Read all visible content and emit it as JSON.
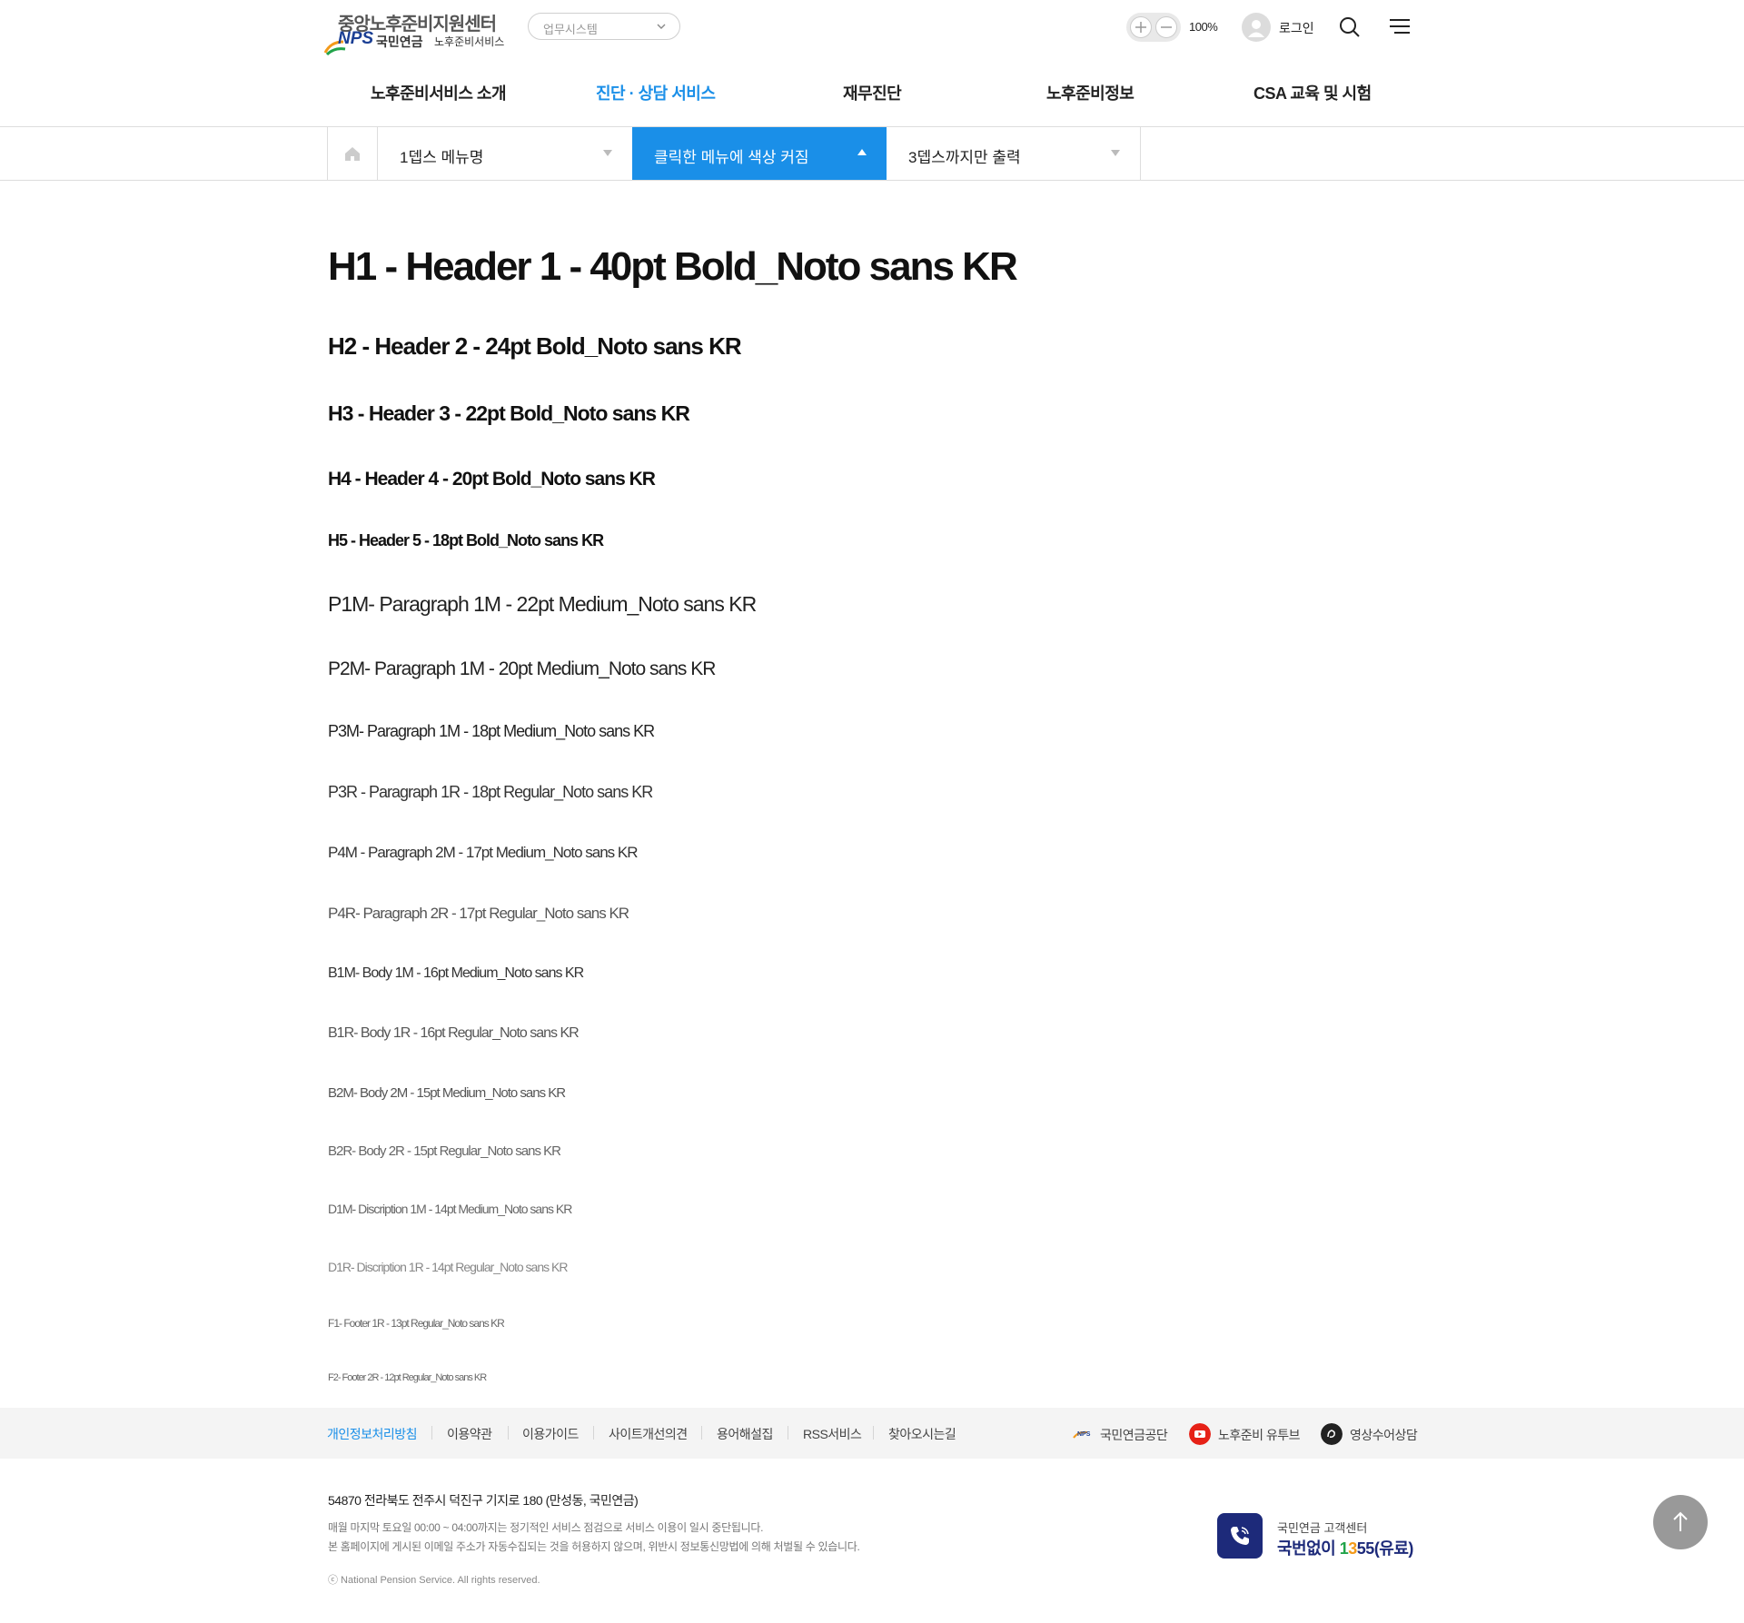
{
  "header": {
    "logo": {
      "center_name": "중앙노후준비지원센터",
      "nps": "NPS",
      "org": "국민연금",
      "service": "노후준비서비스"
    },
    "system_select": {
      "value": "업무시스템"
    },
    "zoom_value": "100%",
    "login_label": "로그인"
  },
  "gnb": {
    "items": [
      {
        "label": "노후준비서비스 소개"
      },
      {
        "label": "진단 · 상담 서비스",
        "active": true
      },
      {
        "label": "재무진단"
      },
      {
        "label": "노후준비정보"
      },
      {
        "label": "CSA 교육 및 시험"
      }
    ]
  },
  "lnb": {
    "depth1": "1뎁스 메뉴명",
    "depth2": "클릭한 메뉴에 색상 커짐",
    "depth3": "3뎁스까지만 출력"
  },
  "typography": {
    "h1": "H1 - Header 1 - 40pt Bold_Noto sans KR",
    "h2": "H2 - Header 2 - 24pt Bold_Noto sans KR",
    "h3": "H3 - Header 3 - 22pt Bold_Noto sans KR",
    "h4": "H4 - Header 4 - 20pt Bold_Noto sans KR",
    "h5": "H5 - Header 5 - 18pt Bold_Noto sans KR",
    "p1m": "P1M- Paragraph 1M - 22pt Medium_Noto sans KR",
    "p2m": "P2M- Paragraph 1M - 20pt Medium_Noto sans KR",
    "p3m": "P3M- Paragraph 1M - 18pt Medium_Noto sans KR",
    "p3r": "P3R - Paragraph 1R - 18pt Regular_Noto sans KR",
    "p4m": "P4M - Paragraph 2M - 17pt Medium_Noto sans KR",
    "p4r": "P4R- Paragraph 2R - 17pt Regular_Noto sans KR",
    "b1m": "B1M- Body 1M - 16pt Medium_Noto sans KR",
    "b1r": "B1R- Body 1R - 16pt Regular_Noto sans KR",
    "b2m": "B2M- Body 2M - 15pt Medium_Noto sans KR",
    "b2r": "B2R- Body 2R - 15pt Regular_Noto sans KR",
    "d1m": "D1M- Discription 1M - 14pt Medium_Noto sans KR",
    "d1r": "D1R- Discription 1R - 14pt Regular_Noto sans KR",
    "f1": "F1- Footer 1R - 13pt Regular_Noto sans KR",
    "f2": "F2- Footer 2R - 12pt Regular_Noto sans KR"
  },
  "footer": {
    "links": [
      {
        "label": "개인정보처리방침",
        "highlight": true
      },
      {
        "label": "이용약관"
      },
      {
        "label": "이용가이드"
      },
      {
        "label": "사이트개선의견"
      },
      {
        "label": "용어해설집"
      },
      {
        "label": "RSS서비스"
      },
      {
        "label": "찾아오시는길"
      }
    ],
    "family_sites": [
      {
        "label": "국민연금공단",
        "icon": "nps-logo-icon"
      },
      {
        "label": "노후준비 유투브",
        "icon": "youtube-icon"
      },
      {
        "label": "영상수어상담",
        "icon": "sign-language-icon"
      }
    ],
    "address": "54870  전라북도 전주시 덕진구 기지로 180 (만성동, 국민연금)",
    "notice1": "매월 마지막 토요일 00:00 ~ 04:00까지는 정기적인 서비스 점검으로 서비스 이용이 일시 중단됩니다.",
    "notice2": "본 홈페이지에 게시된 이메일 주소가 자동수집되는 것을 허용하지 않으며, 위반시 정보통신망법에 의해 처벌될 수 있습니다.",
    "copyright": "ⓒ National Pension Service. All rights reserved.",
    "cs": {
      "label": "국민연금 고객센터",
      "num_prefix": "국번없이 ",
      "num_1": "1",
      "num_3": "3",
      "num_55": "55",
      "num_suffix": "(유료)"
    }
  },
  "colors": {
    "accent": "#1a8fe8",
    "navy": "#1d2a7a"
  }
}
